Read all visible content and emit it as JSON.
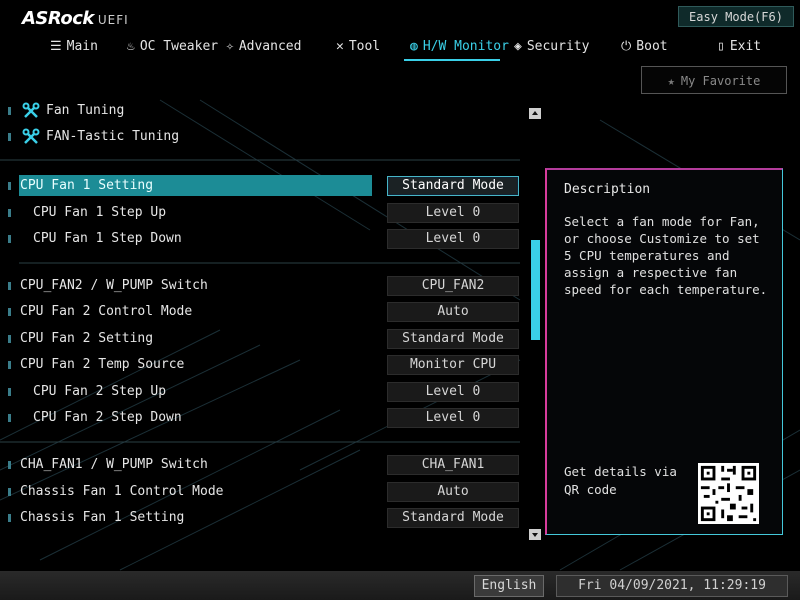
{
  "header": {
    "logo_main": "ASRock",
    "logo_sub": "UEFI",
    "easy_mode_label": "Easy Mode(F6)"
  },
  "nav": {
    "tabs": [
      {
        "label": "Main",
        "icon": "list-icon"
      },
      {
        "label": "OC Tweaker",
        "icon": "flame-icon"
      },
      {
        "label": "Advanced",
        "icon": "star-icon"
      },
      {
        "label": "Tool",
        "icon": "tools-icon"
      },
      {
        "label": "H/W Monitor",
        "icon": "globe-icon"
      },
      {
        "label": "Security",
        "icon": "shield-icon"
      },
      {
        "label": "Boot",
        "icon": "power-icon"
      },
      {
        "label": "Exit",
        "icon": "exit-icon"
      }
    ],
    "active": "H/W Monitor"
  },
  "favorite": {
    "label": "My Favorite"
  },
  "list": {
    "tools": [
      {
        "label": "Fan Tuning",
        "icon": "wrench-icon"
      },
      {
        "label": "FAN-Tastic Tuning",
        "icon": "wrench-icon"
      }
    ],
    "items": [
      {
        "label": "CPU Fan 1 Setting",
        "value": "Standard Mode",
        "selected": true
      },
      {
        "label": "CPU Fan 1 Step Up",
        "value": "Level 0"
      },
      {
        "label": "CPU Fan 1 Step Down",
        "value": "Level 0"
      },
      {
        "label": "CPU_FAN2 / W_PUMP Switch",
        "value": "CPU_FAN2"
      },
      {
        "label": "CPU Fan 2 Control Mode",
        "value": "Auto"
      },
      {
        "label": "CPU Fan 2 Setting",
        "value": "Standard Mode"
      },
      {
        "label": "CPU Fan 2 Temp Source",
        "value": "Monitor CPU"
      },
      {
        "label": "CPU Fan 2 Step Up",
        "value": "Level 0"
      },
      {
        "label": "CPU Fan 2 Step Down",
        "value": "Level 0"
      },
      {
        "label": "CHA_FAN1 / W_PUMP Switch",
        "value": "CHA_FAN1"
      },
      {
        "label": "Chassis Fan 1 Control Mode",
        "value": "Auto"
      },
      {
        "label": "Chassis Fan 1 Setting",
        "value": "Standard Mode"
      }
    ]
  },
  "description": {
    "title": "Description",
    "body": "Select a fan mode for Fan, or choose Customize to set 5 CPU temperatures and assign a respective fan speed for each temperature.",
    "qr_text": "Get details via QR code"
  },
  "footer": {
    "language": "English",
    "datetime": "Fri 04/09/2021, 11:29:19"
  },
  "colors": {
    "accent": "#3ad0e8",
    "selection": "#1c8c96",
    "panel_border_pink": "#d83c9c"
  }
}
